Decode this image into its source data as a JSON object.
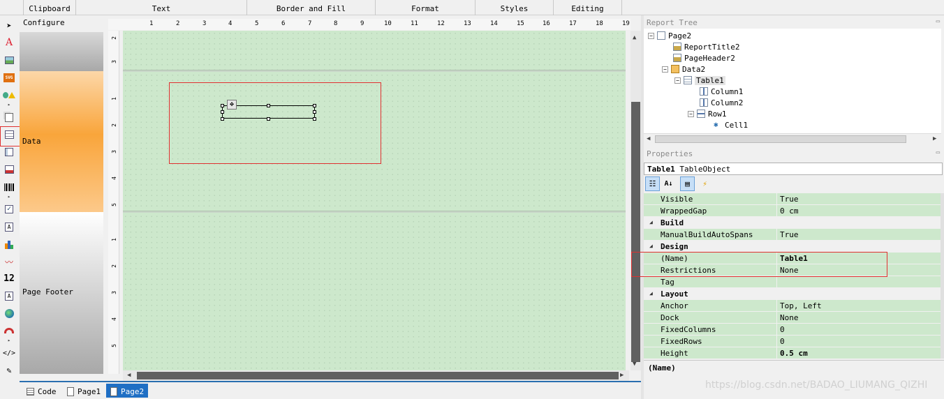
{
  "ribbon": {
    "groups": [
      "Clipboard",
      "Text",
      "Border and Fill",
      "Format",
      "Styles",
      "Editing"
    ]
  },
  "toolbox": {
    "tools": [
      "pointer-icon",
      "text-object-icon",
      "picture-icon",
      "svg-icon",
      "shape-icon",
      "subreport-icon",
      "table-icon",
      "matrix-icon",
      "rich-text-icon",
      "barcode-icon",
      "checkbox-icon",
      "zip-code-icon",
      "chart-icon",
      "sparkline-icon",
      "digital-gauge-icon",
      "cellular-text-icon",
      "map-icon",
      "gauge-icon",
      "html-icon",
      "pen-icon"
    ]
  },
  "bands": {
    "configure": "Configure",
    "data": "Data",
    "page_footer": "Page Footer"
  },
  "rulers": {
    "horizontal": [
      "1",
      "2",
      "3",
      "4",
      "5",
      "6",
      "7",
      "8",
      "9",
      "10",
      "11",
      "12",
      "13",
      "14",
      "15",
      "16",
      "17",
      "18",
      "19"
    ],
    "vertical_header": [
      "2",
      "3"
    ],
    "vertical_data": [
      "1",
      "2",
      "3",
      "4",
      "5"
    ],
    "vertical_footer": [
      "1",
      "2",
      "3",
      "4",
      "5"
    ]
  },
  "tabs": {
    "code": "Code",
    "page1": "Page1",
    "page2": "Page2"
  },
  "report_tree": {
    "title": "Report Tree",
    "nodes": [
      "Page2",
      "ReportTitle2",
      "PageHeader2",
      "Data2",
      "Table1",
      "Column1",
      "Column2",
      "Row1",
      "Cell1"
    ]
  },
  "properties": {
    "title": "Properties",
    "selected_object": "Table1",
    "selected_type": "TableObject",
    "rows": [
      {
        "name": "Visible",
        "value": "True"
      },
      {
        "name": "WrappedGap",
        "value": "0 cm"
      },
      {
        "category": "Build"
      },
      {
        "name": "ManualBuildAutoSpans",
        "value": "True"
      },
      {
        "category": "Design"
      },
      {
        "name": "(Name)",
        "value": "Table1"
      },
      {
        "name": "Restrictions",
        "value": "None"
      },
      {
        "name": "Tag",
        "value": ""
      },
      {
        "category": "Layout"
      },
      {
        "name": "Anchor",
        "value": "Top, Left"
      },
      {
        "name": "Dock",
        "value": "None"
      },
      {
        "name": "FixedColumns",
        "value": "0"
      },
      {
        "name": "FixedRows",
        "value": "0"
      },
      {
        "name": "Height",
        "value": "0.5 cm"
      }
    ],
    "description": "(Name)"
  },
  "watermark": "https://blog.csdn.net/BADAO_LIUMANG_QIZHI",
  "colors": {
    "canvas": "#cde8cc",
    "data_band": "#f9a53b",
    "highlight": "#e03030",
    "active_tab": "#1f6fc4"
  }
}
